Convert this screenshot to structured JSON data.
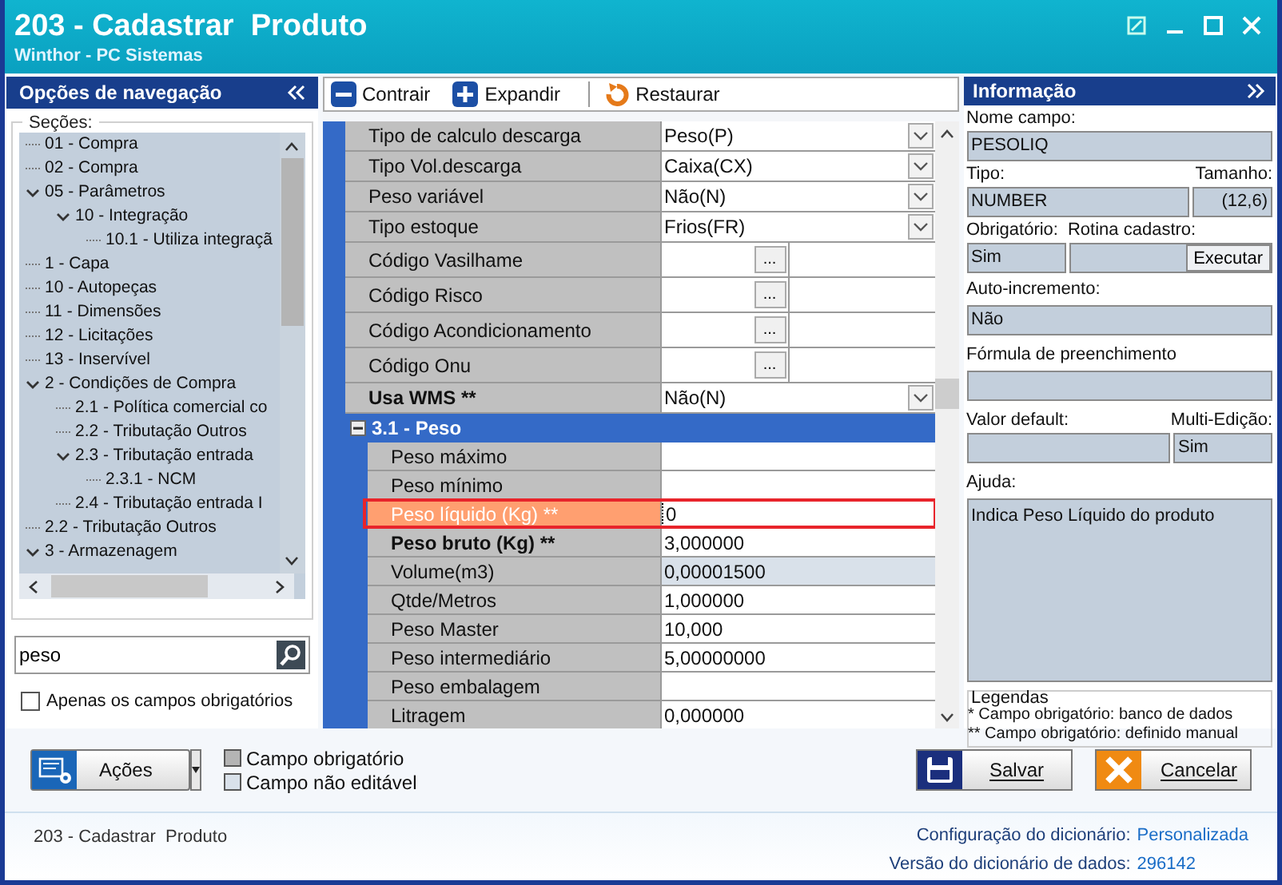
{
  "window": {
    "title": "203 - Cadastrar  Produto",
    "subtitle": "Winthor - PC Sistemas"
  },
  "nav": {
    "title": "Opções de navegação",
    "sections_label": "Seções:",
    "tree": [
      {
        "label": "01 - Compra"
      },
      {
        "label": "02 - Compra"
      },
      {
        "label": "05 - Parâmetros",
        "expanded": true,
        "children": [
          {
            "label": "10 - Integração",
            "expanded": true,
            "children": [
              {
                "label": "10.1 - Utiliza integraçã"
              }
            ]
          }
        ]
      },
      {
        "label": "1 - Capa"
      },
      {
        "label": "10 - Autopeças"
      },
      {
        "label": "11 - Dimensões"
      },
      {
        "label": "12 - Licitações"
      },
      {
        "label": "13 - Inservível"
      },
      {
        "label": "2 - Condições de Compra",
        "expanded": true,
        "children": [
          {
            "label": "2.1 - Política comercial co"
          },
          {
            "label": "2.2 - Tributação Outros"
          },
          {
            "label": "2.3 - Tributação entrada",
            "expanded": true,
            "children": [
              {
                "label": "2.3.1 - NCM"
              }
            ]
          },
          {
            "label": "2.4 - Tributação entrada I"
          }
        ]
      },
      {
        "label": "2.2 - Tributação Outros"
      },
      {
        "label": "3 - Armazenagem",
        "expanded": true
      }
    ],
    "search": {
      "value": "peso"
    },
    "only_required": {
      "label": "Apenas os campos obrigatórios",
      "checked": false
    }
  },
  "toolbar": [
    {
      "kind": "collapse",
      "label": "Contrair"
    },
    {
      "kind": "expand",
      "label": "Expandir"
    },
    {
      "kind": "restore",
      "label": "Restaurar"
    }
  ],
  "grid": {
    "rows": [
      {
        "kind": "dropdown",
        "label": "Tipo de calculo descarga",
        "value": "Peso(P)",
        "bold": false
      },
      {
        "kind": "dropdown",
        "label": "Tipo Vol.descarga",
        "value": "Caixa(CX)",
        "bold": false
      },
      {
        "kind": "dropdown",
        "label": "Peso variável",
        "value": "Não(N)",
        "bold": false
      },
      {
        "kind": "dropdown",
        "label": "Tipo estoque",
        "value": "Frios(FR)",
        "bold": false
      },
      {
        "kind": "lookup",
        "label": "Código Vasilhame",
        "button": "...",
        "bold": false
      },
      {
        "kind": "lookup",
        "label": "Código Risco",
        "button": "...",
        "bold": false
      },
      {
        "kind": "lookup",
        "label": "Código Acondicionamento",
        "button": "...",
        "bold": false
      },
      {
        "kind": "lookup",
        "label": "Código Onu",
        "button": "...",
        "bold": false
      },
      {
        "kind": "dropdown",
        "label": "Usa WMS **",
        "value": "Não(N)",
        "bold": true
      }
    ],
    "group": {
      "title": "3.1 - Peso",
      "expanded": true,
      "rows": [
        {
          "label": "Peso máximo",
          "bold": false,
          "selected": false,
          "editable": true
        },
        {
          "label": "Peso mínimo",
          "bold": false,
          "selected": false,
          "editable": true
        },
        {
          "label": "Peso líquido (Kg) **",
          "value": "0",
          "bold": false,
          "selected": true,
          "editable": true
        },
        {
          "label": "Peso bruto (Kg) **",
          "value": "3,000000",
          "bold": true,
          "selected": false,
          "editable": true
        },
        {
          "label": "Volume(m3)",
          "value": "0,00001500",
          "bold": false,
          "selected": false,
          "editable": false
        },
        {
          "label": "Qtde/Metros",
          "value": "1,000000",
          "bold": false,
          "selected": false,
          "editable": true
        },
        {
          "label": "Peso Master",
          "value": "10,000",
          "bold": false,
          "selected": false,
          "editable": true
        },
        {
          "label": "Peso intermediário",
          "value": "5,00000000",
          "bold": false,
          "selected": false,
          "editable": true
        },
        {
          "label": "Peso embalagem",
          "bold": false,
          "selected": false,
          "editable": true
        },
        {
          "label": "Litragem",
          "value": "0,000000",
          "bold": false,
          "selected": false,
          "editable": true
        }
      ]
    }
  },
  "info": {
    "title": "Informação",
    "field_name_label": "Nome campo:",
    "field_name": "PESOLIQ",
    "type_label": "Tipo:",
    "type": "NUMBER",
    "size_label": "Tamanho:",
    "size": "(12,6)",
    "required_label": "Obrigatório:",
    "required": "Sim",
    "routine_label": "Rotina cadastro:",
    "execute_button": "Executar",
    "autoinc_label": "Auto-incremento:",
    "autoinc": "Não",
    "formula_label": "Fórmula de preenchimento",
    "default_label": "Valor default:",
    "multi_label": "Multi-Edição:",
    "multi": "Sim",
    "help_label": "Ajuda:",
    "help": "Indica Peso Líquido do produto",
    "legend_title": "Legendas",
    "legend": [
      "* Campo obrigatório: banco de dados",
      "** Campo obrigatório: definido manual"
    ]
  },
  "actions_button": "Ações",
  "legend_swatches": [
    {
      "label": "Campo obrigatório",
      "color": "#b4b4b4"
    },
    {
      "label": "Campo não editável",
      "color": "#d9e1ea"
    }
  ],
  "save_button": "Salvar",
  "cancel_button": "Cancelar",
  "status": {
    "screen": "203 - Cadastrar  Produto",
    "config_label": "Configuração do dicionário:",
    "config_value": "Personalizada",
    "version_label": "Versão do dicionário de dados:",
    "version_value": "296142"
  }
}
